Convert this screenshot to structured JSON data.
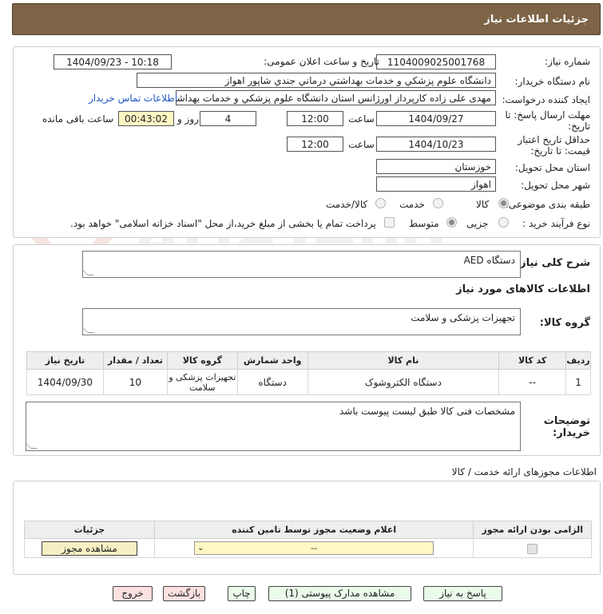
{
  "header": {
    "title": "جزئیات اطلاعات نیاز"
  },
  "form": {
    "need_number_label": "شماره نیاز:",
    "need_number": "1104009025001768",
    "announce_label": "تاریخ و ساعت اعلان عمومی:",
    "announce_value": "1404/09/23 - 10:18",
    "buyer_org_label": "نام دستگاه خریدار:",
    "buyer_org": "دانشگاه علوم پزشکي و خدمات بهداشتي درماني جندي شاپور اهواز",
    "creator_label": "ایجاد کننده درخواست:",
    "creator": "مهدی علی زاده کارپرداز اورژانس استان دانشگاه علوم پزشکي و خدمات بهداشت",
    "contact_link": "اطلاعات تماس خریدار",
    "send_deadline_label_1": "مهلت ارسال پاسخ: تا",
    "send_deadline_label_2": "تاریخ:",
    "send_date": "1404/09/27",
    "time_label": "ساعت",
    "send_time": "12:00",
    "days_value": "4",
    "days_label": "روز و",
    "remaining_time": "00:43:02",
    "remaining_label": "ساعت باقی مانده",
    "validity_label_1": "حداقل تاریخ اعتبار",
    "validity_label_2": "قیمت: تا تاریخ:",
    "validity_date": "1404/10/23",
    "validity_time": "12:00",
    "province_label": "استان محل تحویل:",
    "province": "خوزستان",
    "city_label": "شهر محل تحویل:",
    "city": "اهواز",
    "category_label": "طبقه بندی موضوعی:",
    "category_options": [
      "کالا",
      "خدمت",
      "کالا/خدمت"
    ],
    "process_label": "نوع فرآیند خرید :",
    "process_options": [
      "جزیی",
      "متوسط"
    ],
    "payment_note": "پرداخت تمام یا بخشی از مبلغ خرید،از محل \"اسناد خزانه اسلامی\" خواهد بود."
  },
  "description": {
    "label": "شرح کلی نیاز:",
    "value": "دستگاه AED"
  },
  "goods_section": {
    "title": "اطلاعات کالاهای مورد نیاز",
    "group_label": "گروه کالا:",
    "group_value": "تجهیزات پزشکی و سلامت",
    "table": {
      "headers": [
        "ردیف",
        "کد کالا",
        "نام کالا",
        "واحد شمارش",
        "گروه کالا",
        "تعداد / مقدار",
        "تاریخ نیاز"
      ],
      "rows": [
        [
          "1",
          "--",
          "دستگاه الکتروشوک",
          "دستگاه",
          "تجهیزات پزشکی و سلامت",
          "10",
          "1404/09/30"
        ]
      ]
    },
    "buyer_notes_label_1": "توضیحات",
    "buyer_notes_label_2": "خریدار:",
    "buyer_notes": "مشخصات فنی کالا طبق لیست پیوست باشد"
  },
  "permits": {
    "title": "اطلاعات مجوزهای ارائه خدمت / کالا",
    "headers": [
      "الزامی بودن ارائه مجوز",
      "اعلام وضعیت مجوز توسط تامین کننده",
      "جزئیات"
    ],
    "select_value": "--",
    "view_button": "مشاهده مجوز"
  },
  "buttons": {
    "reply": "پاسخ به نیاز",
    "attachments": "مشاهده مدارک پیوستی (1)",
    "print": "چاپ",
    "back": "بازگشت",
    "exit": "خروج"
  },
  "watermark": {
    "text": "AriaTender.net"
  }
}
